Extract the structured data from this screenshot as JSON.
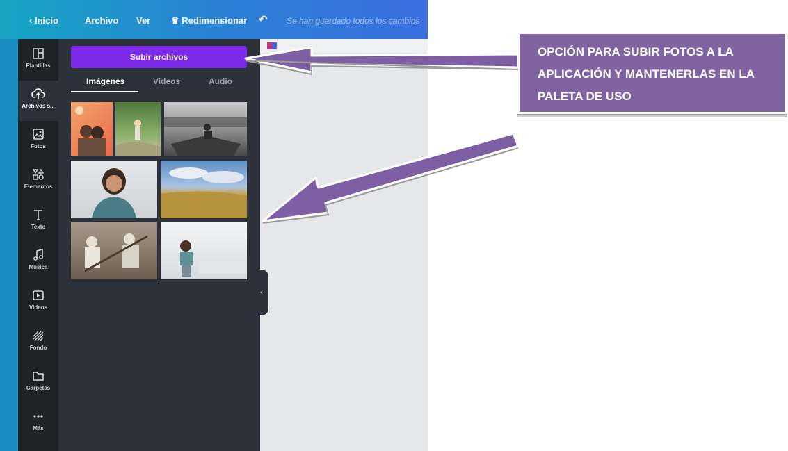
{
  "topbar": {
    "back": "Inicio",
    "file": "Archivo",
    "view": "Ver",
    "resize": "Redimensionar",
    "saved": "Se han guardado todos los cambios"
  },
  "rail": [
    {
      "label": "Plantillas",
      "icon": "templates-icon"
    },
    {
      "label": "Archivos s...",
      "icon": "upload-cloud-icon"
    },
    {
      "label": "Fotos",
      "icon": "photo-icon"
    },
    {
      "label": "Elementos",
      "icon": "shapes-icon"
    },
    {
      "label": "Texto",
      "icon": "text-icon"
    },
    {
      "label": "Música",
      "icon": "music-icon"
    },
    {
      "label": "Videos",
      "icon": "video-icon"
    },
    {
      "label": "Fondo",
      "icon": "background-icon"
    },
    {
      "label": "Carpetas",
      "icon": "folder-icon"
    },
    {
      "label": "Más",
      "icon": "more-icon"
    }
  ],
  "panel": {
    "upload_label": "Subir archivos",
    "tabs": [
      "Imágenes",
      "Videos",
      "Audio"
    ]
  },
  "callout": {
    "text": "OPCIÓN PARA SUBIR FOTOS A LA APLICACIÓN Y MANTENERLAS EN LA PALETA DE USO"
  },
  "colors": {
    "accent": "#7d2ae8",
    "callout": "#8064a2",
    "arrow": "#7e5fa3"
  }
}
